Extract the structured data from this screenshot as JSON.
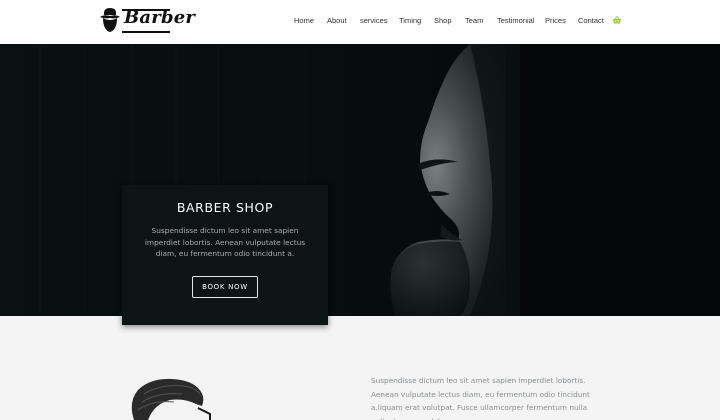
{
  "brand": {
    "name": "Barber"
  },
  "nav": {
    "items": [
      {
        "label": "Home"
      },
      {
        "label": "About"
      },
      {
        "label": "services"
      },
      {
        "label": "Timing"
      },
      {
        "label": "Shop"
      },
      {
        "label": "Team"
      },
      {
        "label": "Testimonial"
      },
      {
        "label": "Prices"
      },
      {
        "label": "Contact"
      }
    ],
    "cart_icon": "shopping-basket-icon"
  },
  "hero": {
    "title": "BARBER SHOP",
    "text": "Suspendisse dictum leo sit amet sapien imperdiet lobortis. Aenean vulputate lectus diam, eu fermentum odio tincidunt a.",
    "button_label": "BOOK NOW"
  },
  "about": {
    "text": "Suspendisse dictum leo sit amet sapien imperdiet lobortis. Aenean vulputate lectus diam, eu fermentum odio tincidunt a.liquam erat volutpat. Fusce ullamcorper fermentum nulla pellentesque sodales."
  },
  "colors": {
    "accent": "#9acd32",
    "hero_bg": "#070c0e",
    "card_bg": "#0c1416",
    "section_bg": "#f4f4f4"
  }
}
